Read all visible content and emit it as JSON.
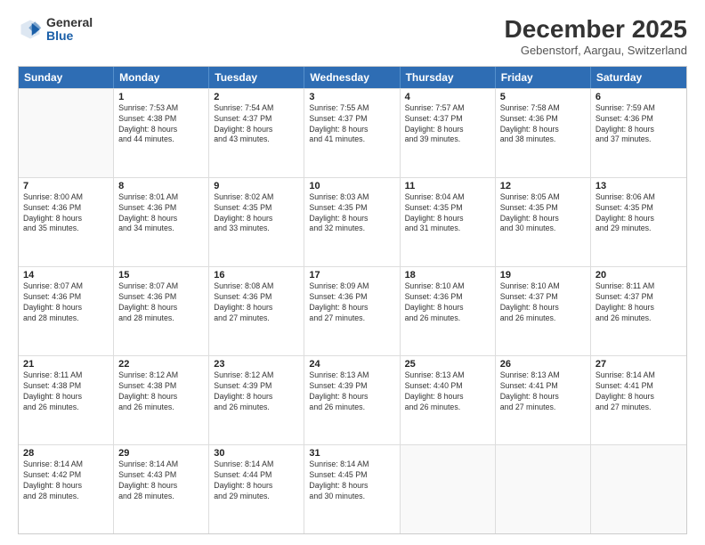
{
  "logo": {
    "general": "General",
    "blue": "Blue"
  },
  "title": "December 2025",
  "subtitle": "Gebenstorf, Aargau, Switzerland",
  "calendar": {
    "headers": [
      "Sunday",
      "Monday",
      "Tuesday",
      "Wednesday",
      "Thursday",
      "Friday",
      "Saturday"
    ],
    "rows": [
      [
        {
          "day": "",
          "sunrise": "",
          "sunset": "",
          "daylight": ""
        },
        {
          "day": "1",
          "sunrise": "Sunrise: 7:53 AM",
          "sunset": "Sunset: 4:38 PM",
          "daylight": "Daylight: 8 hours",
          "daylight2": "and 44 minutes."
        },
        {
          "day": "2",
          "sunrise": "Sunrise: 7:54 AM",
          "sunset": "Sunset: 4:37 PM",
          "daylight": "Daylight: 8 hours",
          "daylight2": "and 43 minutes."
        },
        {
          "day": "3",
          "sunrise": "Sunrise: 7:55 AM",
          "sunset": "Sunset: 4:37 PM",
          "daylight": "Daylight: 8 hours",
          "daylight2": "and 41 minutes."
        },
        {
          "day": "4",
          "sunrise": "Sunrise: 7:57 AM",
          "sunset": "Sunset: 4:37 PM",
          "daylight": "Daylight: 8 hours",
          "daylight2": "and 39 minutes."
        },
        {
          "day": "5",
          "sunrise": "Sunrise: 7:58 AM",
          "sunset": "Sunset: 4:36 PM",
          "daylight": "Daylight: 8 hours",
          "daylight2": "and 38 minutes."
        },
        {
          "day": "6",
          "sunrise": "Sunrise: 7:59 AM",
          "sunset": "Sunset: 4:36 PM",
          "daylight": "Daylight: 8 hours",
          "daylight2": "and 37 minutes."
        }
      ],
      [
        {
          "day": "7",
          "sunrise": "Sunrise: 8:00 AM",
          "sunset": "Sunset: 4:36 PM",
          "daylight": "Daylight: 8 hours",
          "daylight2": "and 35 minutes."
        },
        {
          "day": "8",
          "sunrise": "Sunrise: 8:01 AM",
          "sunset": "Sunset: 4:36 PM",
          "daylight": "Daylight: 8 hours",
          "daylight2": "and 34 minutes."
        },
        {
          "day": "9",
          "sunrise": "Sunrise: 8:02 AM",
          "sunset": "Sunset: 4:35 PM",
          "daylight": "Daylight: 8 hours",
          "daylight2": "and 33 minutes."
        },
        {
          "day": "10",
          "sunrise": "Sunrise: 8:03 AM",
          "sunset": "Sunset: 4:35 PM",
          "daylight": "Daylight: 8 hours",
          "daylight2": "and 32 minutes."
        },
        {
          "day": "11",
          "sunrise": "Sunrise: 8:04 AM",
          "sunset": "Sunset: 4:35 PM",
          "daylight": "Daylight: 8 hours",
          "daylight2": "and 31 minutes."
        },
        {
          "day": "12",
          "sunrise": "Sunrise: 8:05 AM",
          "sunset": "Sunset: 4:35 PM",
          "daylight": "Daylight: 8 hours",
          "daylight2": "and 30 minutes."
        },
        {
          "day": "13",
          "sunrise": "Sunrise: 8:06 AM",
          "sunset": "Sunset: 4:35 PM",
          "daylight": "Daylight: 8 hours",
          "daylight2": "and 29 minutes."
        }
      ],
      [
        {
          "day": "14",
          "sunrise": "Sunrise: 8:07 AM",
          "sunset": "Sunset: 4:36 PM",
          "daylight": "Daylight: 8 hours",
          "daylight2": "and 28 minutes."
        },
        {
          "day": "15",
          "sunrise": "Sunrise: 8:07 AM",
          "sunset": "Sunset: 4:36 PM",
          "daylight": "Daylight: 8 hours",
          "daylight2": "and 28 minutes."
        },
        {
          "day": "16",
          "sunrise": "Sunrise: 8:08 AM",
          "sunset": "Sunset: 4:36 PM",
          "daylight": "Daylight: 8 hours",
          "daylight2": "and 27 minutes."
        },
        {
          "day": "17",
          "sunrise": "Sunrise: 8:09 AM",
          "sunset": "Sunset: 4:36 PM",
          "daylight": "Daylight: 8 hours",
          "daylight2": "and 27 minutes."
        },
        {
          "day": "18",
          "sunrise": "Sunrise: 8:10 AM",
          "sunset": "Sunset: 4:36 PM",
          "daylight": "Daylight: 8 hours",
          "daylight2": "and 26 minutes."
        },
        {
          "day": "19",
          "sunrise": "Sunrise: 8:10 AM",
          "sunset": "Sunset: 4:37 PM",
          "daylight": "Daylight: 8 hours",
          "daylight2": "and 26 minutes."
        },
        {
          "day": "20",
          "sunrise": "Sunrise: 8:11 AM",
          "sunset": "Sunset: 4:37 PM",
          "daylight": "Daylight: 8 hours",
          "daylight2": "and 26 minutes."
        }
      ],
      [
        {
          "day": "21",
          "sunrise": "Sunrise: 8:11 AM",
          "sunset": "Sunset: 4:38 PM",
          "daylight": "Daylight: 8 hours",
          "daylight2": "and 26 minutes."
        },
        {
          "day": "22",
          "sunrise": "Sunrise: 8:12 AM",
          "sunset": "Sunset: 4:38 PM",
          "daylight": "Daylight: 8 hours",
          "daylight2": "and 26 minutes."
        },
        {
          "day": "23",
          "sunrise": "Sunrise: 8:12 AM",
          "sunset": "Sunset: 4:39 PM",
          "daylight": "Daylight: 8 hours",
          "daylight2": "and 26 minutes."
        },
        {
          "day": "24",
          "sunrise": "Sunrise: 8:13 AM",
          "sunset": "Sunset: 4:39 PM",
          "daylight": "Daylight: 8 hours",
          "daylight2": "and 26 minutes."
        },
        {
          "day": "25",
          "sunrise": "Sunrise: 8:13 AM",
          "sunset": "Sunset: 4:40 PM",
          "daylight": "Daylight: 8 hours",
          "daylight2": "and 26 minutes."
        },
        {
          "day": "26",
          "sunrise": "Sunrise: 8:13 AM",
          "sunset": "Sunset: 4:41 PM",
          "daylight": "Daylight: 8 hours",
          "daylight2": "and 27 minutes."
        },
        {
          "day": "27",
          "sunrise": "Sunrise: 8:14 AM",
          "sunset": "Sunset: 4:41 PM",
          "daylight": "Daylight: 8 hours",
          "daylight2": "and 27 minutes."
        }
      ],
      [
        {
          "day": "28",
          "sunrise": "Sunrise: 8:14 AM",
          "sunset": "Sunset: 4:42 PM",
          "daylight": "Daylight: 8 hours",
          "daylight2": "and 28 minutes."
        },
        {
          "day": "29",
          "sunrise": "Sunrise: 8:14 AM",
          "sunset": "Sunset: 4:43 PM",
          "daylight": "Daylight: 8 hours",
          "daylight2": "and 28 minutes."
        },
        {
          "day": "30",
          "sunrise": "Sunrise: 8:14 AM",
          "sunset": "Sunset: 4:44 PM",
          "daylight": "Daylight: 8 hours",
          "daylight2": "and 29 minutes."
        },
        {
          "day": "31",
          "sunrise": "Sunrise: 8:14 AM",
          "sunset": "Sunset: 4:45 PM",
          "daylight": "Daylight: 8 hours",
          "daylight2": "and 30 minutes."
        },
        {
          "day": "",
          "sunrise": "",
          "sunset": "",
          "daylight": ""
        },
        {
          "day": "",
          "sunrise": "",
          "sunset": "",
          "daylight": ""
        },
        {
          "day": "",
          "sunrise": "",
          "sunset": "",
          "daylight": ""
        }
      ]
    ]
  }
}
